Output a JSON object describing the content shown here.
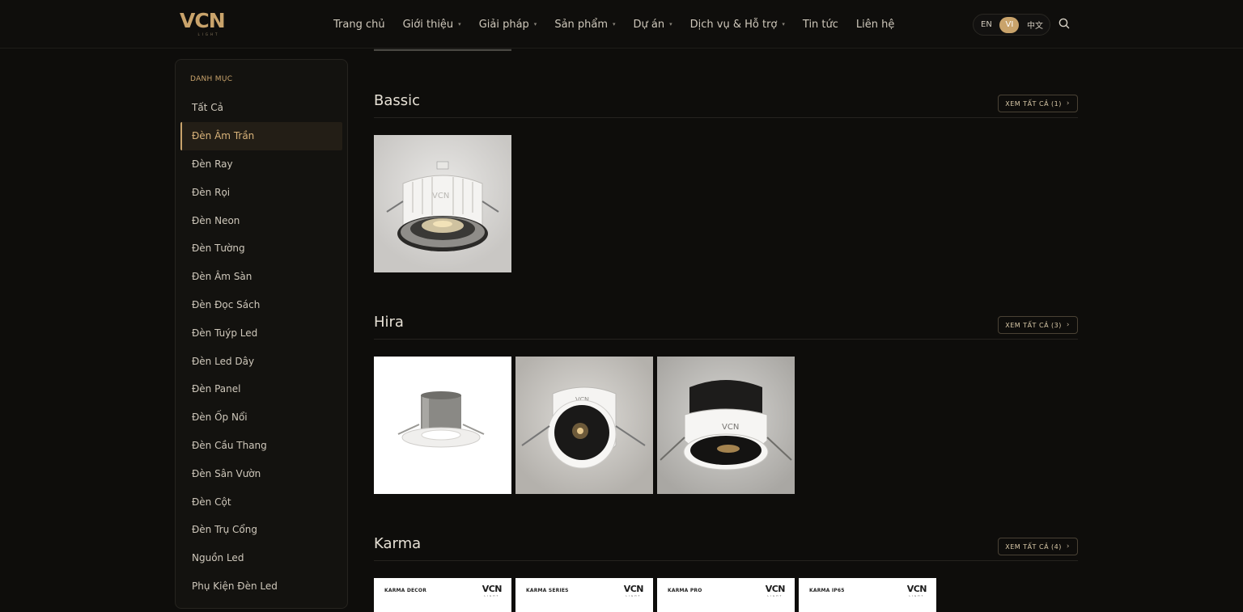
{
  "header": {
    "logo_text": "VCN",
    "logo_sub": "LIGHT",
    "nav": [
      {
        "label": "Trang chủ",
        "has_caret": false
      },
      {
        "label": "Giới thiệu",
        "has_caret": true
      },
      {
        "label": "Giải pháp",
        "has_caret": true
      },
      {
        "label": "Sản phẩm",
        "has_caret": true
      },
      {
        "label": "Dự án",
        "has_caret": true
      },
      {
        "label": "Dịch vụ & Hỗ trợ",
        "has_caret": true
      },
      {
        "label": "Tin tức",
        "has_caret": false
      },
      {
        "label": "Liên hệ",
        "has_caret": false
      }
    ],
    "lang": {
      "en": "EN",
      "vi": "VI",
      "zh": "中文",
      "active": "VI"
    },
    "search_icon": "search-icon"
  },
  "sidebar": {
    "title": "DANH MỤC",
    "active_index": 1,
    "items": [
      "Tất Cả",
      "Đèn Âm Trần",
      "Đèn Ray",
      "Đèn Rọi",
      "Đèn Neon",
      "Đèn Tường",
      "Đèn Âm Sàn",
      "Đèn Đọc Sách",
      "Đèn Tuýp Led",
      "Đèn Led Dây",
      "Đèn Panel",
      "Đèn Ốp Nổi",
      "Đèn Cầu Thang",
      "Đèn Sân Vườn",
      "Đèn Cột",
      "Đèn Trụ Cổng",
      "Nguồn Led",
      "Phụ Kiện Đèn Led"
    ]
  },
  "sections": [
    {
      "title": "Bassic",
      "view_all": "XEM TẤT CẢ",
      "count": "(1)"
    },
    {
      "title": "Hira",
      "view_all": "XEM TẤT CẢ",
      "count": "(3)"
    },
    {
      "title": "Karma",
      "view_all": "XEM TẤT CẢ",
      "count": "(4)"
    }
  ],
  "karma_cards": [
    {
      "label": "KARMA DECOR",
      "logo": "VCN"
    },
    {
      "label": "KARMA SERIES",
      "logo": "VCN"
    },
    {
      "label": "KARMA PRO",
      "logo": "VCN"
    },
    {
      "label": "KARMA IP65",
      "logo": "VCN"
    }
  ],
  "product_logo": "VCN",
  "colors": {
    "accent": "#c9a36b",
    "background": "#0e0d0b",
    "panel": "#13120f"
  }
}
